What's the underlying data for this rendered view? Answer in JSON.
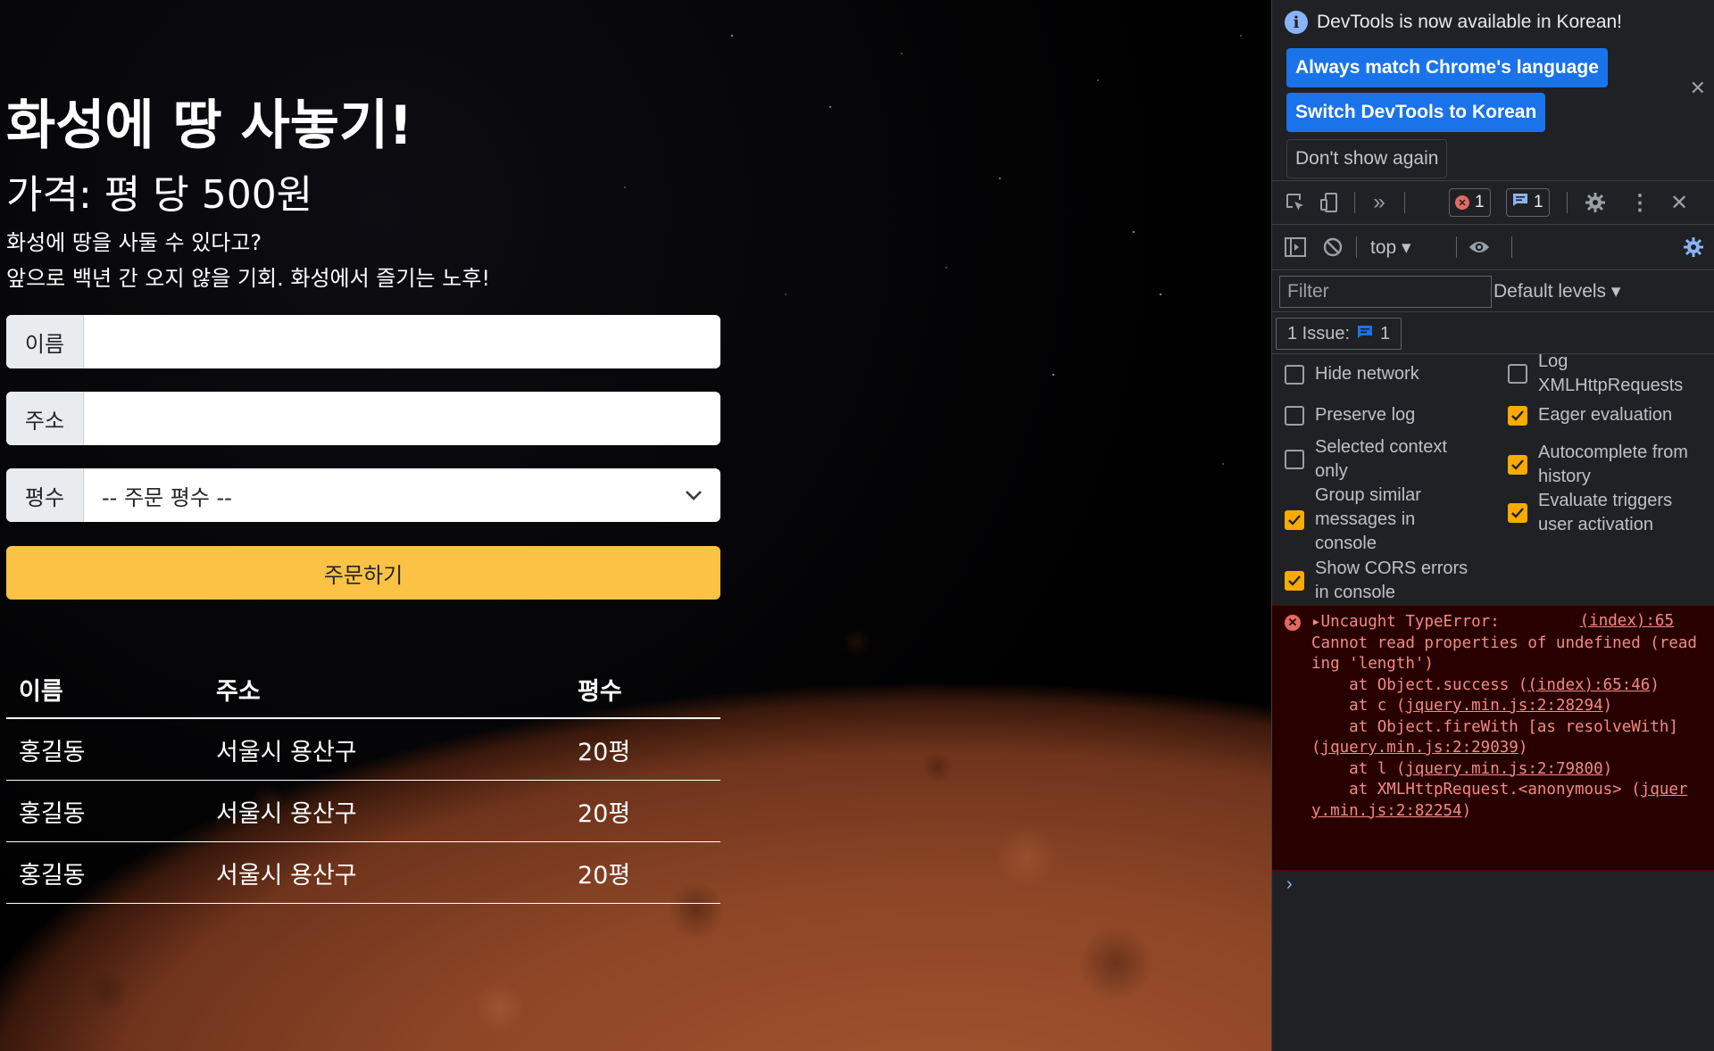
{
  "page": {
    "title": "화성에 땅 사놓기!",
    "price": "가격: 평 당 500원",
    "desc_line1": "화성에 땅을 사둘 수 있다고?",
    "desc_line2": "앞으로 백년 간 오지 않을 기회. 화성에서 즐기는 노후!",
    "form": {
      "name_label": "이름",
      "name_value": "",
      "address_label": "주소",
      "address_value": "",
      "size_label": "평수",
      "size_selected": "-- 주문 평수 --",
      "submit_label": "주문하기"
    },
    "table": {
      "headers": [
        "이름",
        "주소",
        "평수"
      ],
      "rows": [
        [
          "홍길동",
          "서울시 용산구",
          "20평"
        ],
        [
          "홍길동",
          "서울시 용산구",
          "20평"
        ],
        [
          "홍길동",
          "서울시 용산구",
          "20평"
        ]
      ]
    },
    "colors": {
      "button": "#fbc246",
      "text": "#ffffff"
    }
  },
  "devtools": {
    "infobar": {
      "message": "DevTools is now available in Korean!",
      "btn_match": "Always match Chrome's language",
      "btn_switch": "Switch DevTools to Korean",
      "btn_dont_show": "Don't show again"
    },
    "toolbar": {
      "error_count": "1",
      "message_count": "1"
    },
    "console_toolbar": {
      "context": "top"
    },
    "filter": {
      "placeholder": "Filter",
      "levels": "Default levels"
    },
    "issues": {
      "label": "1 Issue:",
      "count": "1"
    },
    "settings": {
      "hide_network": "Hide network",
      "preserve_log": "Preserve log",
      "selected_context": "Selected context only",
      "group_similar": "Group similar messages in console",
      "show_cors": "Show CORS errors in console",
      "log_xhr": "Log XMLHttpRequests",
      "eager_eval": "Eager evaluation",
      "autocomplete": "Autocomplete from history",
      "eval_triggers": "Evaluate triggers user activation"
    },
    "error": {
      "link": "(index):65",
      "line1": "Uncaught TypeError:",
      "line2": "Cannot read properties of undefined (reading 'length')",
      "at1_pre": "    at Object.success (",
      "at1_link": "(index):65:46",
      "at2_pre": "    at c (",
      "at2_link": "jquery.min.js:2:28294",
      "at3_pre": "    at Object.fireWith [as resolveWith] (",
      "at3_link": "jquery.min.js:2:29039",
      "at4_pre": "    at l (",
      "at4_link": "jquery.min.js:2:79800",
      "at5_pre": "    at XMLHttpRequest.<anonymous> (",
      "at5_link": "jquery.min.js:2:82254",
      "close": ")"
    }
  }
}
